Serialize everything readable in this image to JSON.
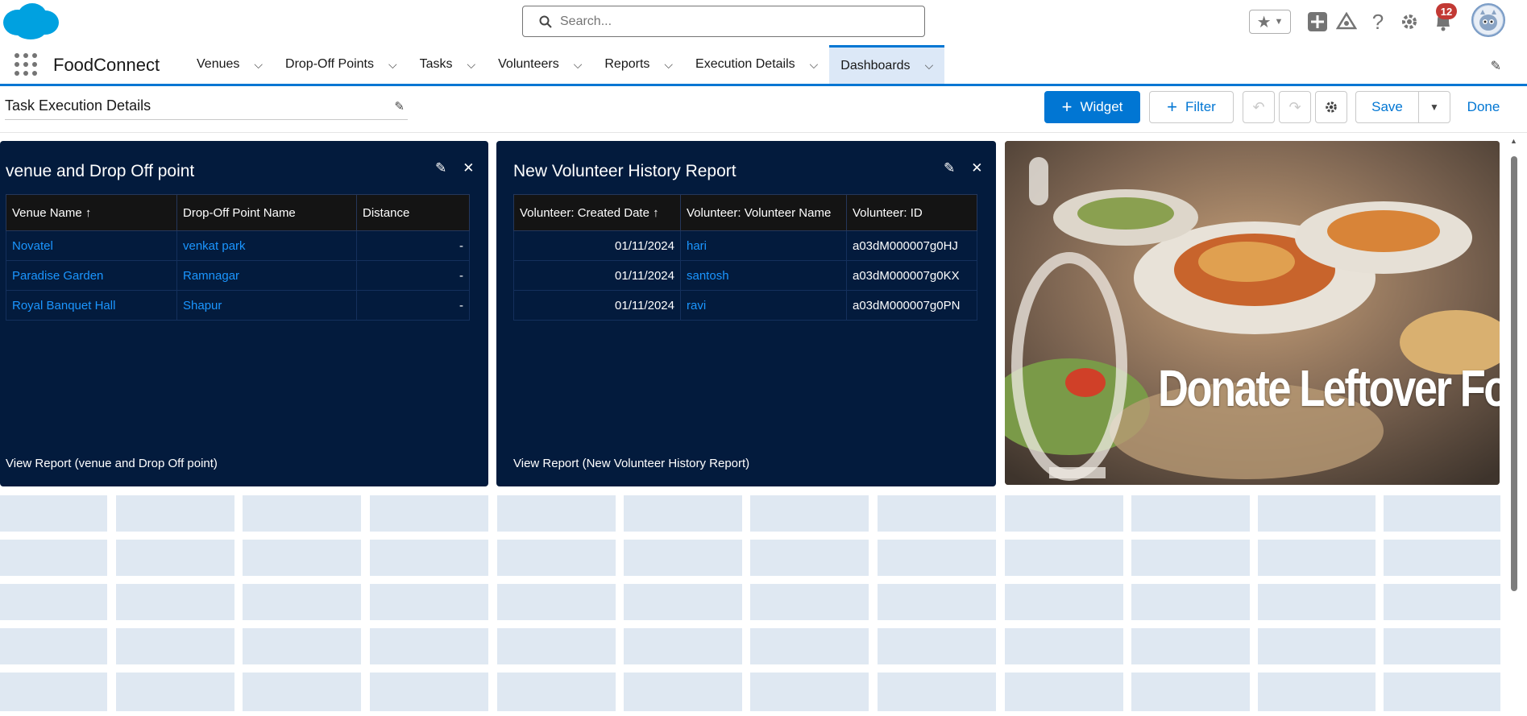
{
  "header": {
    "search_placeholder": "Search...",
    "notification_count": "12"
  },
  "nav": {
    "app_name": "FoodConnect",
    "tabs": [
      {
        "label": "Venues"
      },
      {
        "label": "Drop-Off Points"
      },
      {
        "label": "Tasks"
      },
      {
        "label": "Volunteers"
      },
      {
        "label": "Reports"
      },
      {
        "label": "Execution Details"
      },
      {
        "label": "Dashboards"
      }
    ]
  },
  "toolbar": {
    "dashboard_name": "Task Execution Details",
    "widget_label": "Widget",
    "filter_label": "Filter",
    "save_label": "Save",
    "done_label": "Done"
  },
  "panel1": {
    "title": "venue and Drop Off point",
    "headers": [
      "Venue Name ↑",
      "Drop-Off Point Name",
      "Distance"
    ],
    "rows": [
      [
        "Novatel",
        "venkat park",
        "-"
      ],
      [
        "Paradise Garden",
        "Ramnagar",
        "-"
      ],
      [
        "Royal Banquet Hall",
        "Shapur",
        "-"
      ]
    ],
    "view_report": "View Report (venue and Drop Off point)"
  },
  "panel2": {
    "title": "New Volunteer History Report",
    "headers": [
      "Volunteer: Created Date ↑",
      "Volunteer: Volunteer Name",
      "Volunteer: ID"
    ],
    "rows": [
      [
        "01/11/2024",
        "hari",
        "a03dM000007g0HJ"
      ],
      [
        "01/11/2024",
        "santosh",
        "a03dM000007g0KX"
      ],
      [
        "01/11/2024",
        "ravi",
        "a03dM000007g0PN"
      ]
    ],
    "view_report": "View Report (New Volunteer History Report)"
  },
  "image_tile": {
    "caption": "Donate Leftover Food"
  },
  "colors": {
    "brand": "#0176d3",
    "panel_bg": "#031b3d",
    "link": "#1b96ff"
  }
}
